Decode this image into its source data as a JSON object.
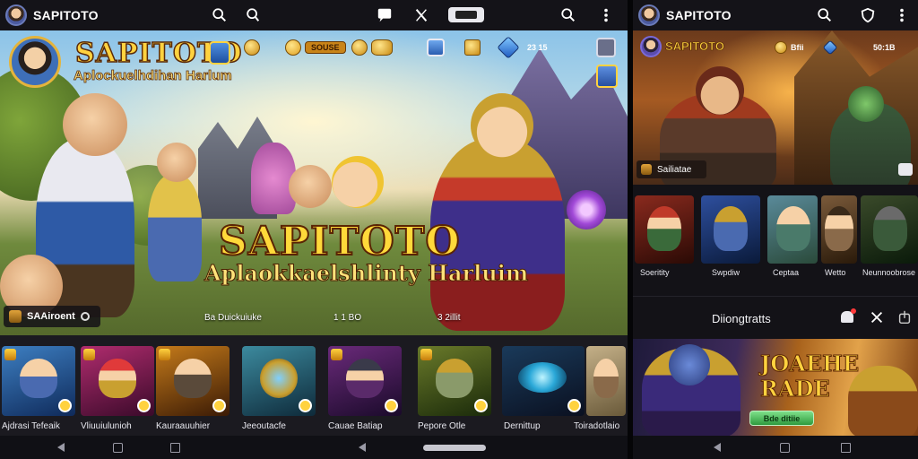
{
  "left_app": {
    "title": "SAPITOTO",
    "hero": {
      "brand": "SAPITOTO",
      "brand_subtitle": "Aplockuelhdihan Harlum",
      "hud": {
        "pill_1": "SOUSE",
        "num_1": "23 15"
      },
      "headline": "SAPITOTO",
      "subheadline": "Aplaokkaelshlinty Harluim",
      "badge_label": "SAAiroent",
      "footer_1": "Ba Duickuiuke",
      "footer_2": "1 1 BO",
      "footer_3": "3 2illit"
    },
    "thumbnails": [
      {
        "label": "Ajdrasi Tefeaik",
        "color": "#3d7fc2"
      },
      {
        "label": "Vliuuiulunioh",
        "color": "#b02c6e"
      },
      {
        "label": "Kauraauuhier",
        "color": "#c47a1a"
      },
      {
        "label": "Jeeoutacfe",
        "color": "#3c8a9e"
      },
      {
        "label": "Cauae Batiap",
        "color": "#6a2a7a"
      },
      {
        "label": "Pepore Otle",
        "color": "#6a7a2a"
      },
      {
        "label": "Dernittup",
        "color": "#1a3a5a"
      },
      {
        "label": "Toiradotlaio",
        "color": "#c4b088"
      }
    ]
  },
  "right_app": {
    "title": "SAPITOTO",
    "hero": {
      "brand": "SAPITOTO",
      "hud_1": "Bfii",
      "hud_2": "50:1B",
      "badge_label": "Sailiatae"
    },
    "thumbnails": [
      {
        "label": "Soeritity",
        "color": "#8a2a1e"
      },
      {
        "label": "Swpdiw",
        "color": "#2e4f9e"
      },
      {
        "label": "Ceptaa",
        "color": "#5a8a9a"
      },
      {
        "label": "Wetto",
        "color": "#7a5a3a"
      },
      {
        "label": "Neunnoobrose",
        "color": "#3a4a2a"
      }
    ],
    "notifications_title": "Diiongtratts",
    "banner": {
      "title_line1": "JOAEHE",
      "title_line2": "RADE",
      "button": "Bde ditiie"
    }
  }
}
